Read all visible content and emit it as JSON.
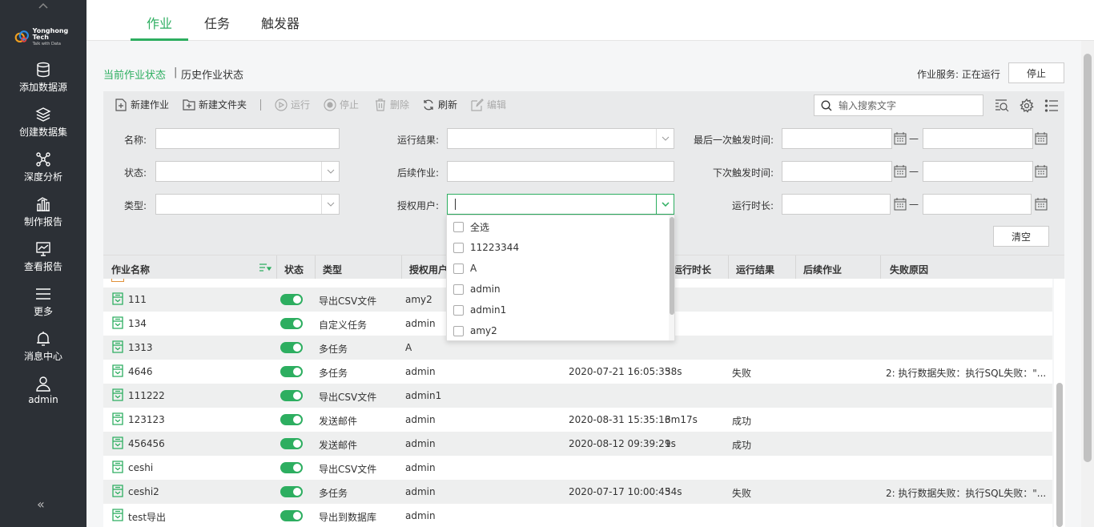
{
  "sidebar": {
    "logo_line1": "Yonghong Tech",
    "logo_line2": "Talk with Data",
    "items": [
      {
        "label": "添加数据源",
        "icon": "database-icon"
      },
      {
        "label": "创建数据集",
        "icon": "layers-icon"
      },
      {
        "label": "深度分析",
        "icon": "network-icon"
      },
      {
        "label": "制作报告",
        "icon": "bar-chart-icon"
      },
      {
        "label": "查看报告",
        "icon": "monitor-chart-icon"
      },
      {
        "label": "更多",
        "icon": "menu-icon"
      },
      {
        "label": "消息中心",
        "icon": "bell-icon"
      },
      {
        "label": "admin",
        "icon": "user-icon"
      }
    ],
    "collapse": "«"
  },
  "tabs": [
    {
      "label": "作业",
      "active": true
    },
    {
      "label": "任务",
      "active": false
    },
    {
      "label": "触发器",
      "active": false
    }
  ],
  "status": {
    "current": "当前作业状态",
    "separator": "|",
    "history": "历史作业状态",
    "service_text": "作业服务: 正在运行",
    "stop_label": "停止"
  },
  "toolbar": {
    "new_job": "新建作业",
    "new_folder": "新建文件夹",
    "run": "运行",
    "stop": "停止",
    "delete": "删除",
    "refresh": "刷新",
    "edit": "编辑",
    "search_placeholder": "输入搜索文字"
  },
  "filters": {
    "name": "名称:",
    "status": "状态:",
    "type": "类型:",
    "run_result": "运行结果:",
    "next_job": "后续作业:",
    "auth_user": "授权用户:",
    "last_trigger": "最后一次触发时间:",
    "next_trigger": "下次触发时间:",
    "run_duration": "运行时长:",
    "dash": "—",
    "clear": "清空"
  },
  "dropdown_options": [
    "全选",
    "11223344",
    "A",
    "admin",
    "admin1",
    "amy2"
  ],
  "table": {
    "headers": [
      "作业名称",
      "状态",
      "类型",
      "授权用户",
      "运行时长",
      "运行结果",
      "后续作业",
      "失败原因"
    ],
    "rows": [
      {
        "name": "111",
        "type": "导出CSV文件",
        "user": "amy2",
        "time": "",
        "duration": "",
        "result": "",
        "reason": ""
      },
      {
        "name": "134",
        "type": "自定义任务",
        "user": "admin",
        "time": "",
        "duration": "",
        "result": "",
        "reason": ""
      },
      {
        "name": "1313",
        "type": "多任务",
        "user": "A",
        "time": "",
        "duration": "",
        "result": "",
        "reason": ""
      },
      {
        "name": "4646",
        "type": "多任务",
        "user": "admin",
        "time": "2020-07-21 16:05:35",
        "duration": "38s",
        "result": "失败",
        "reason": "2: 执行数据失败：执行SQL失败：\"..."
      },
      {
        "name": "111222",
        "type": "导出CSV文件",
        "user": "admin1",
        "time": "",
        "duration": "",
        "result": "",
        "reason": ""
      },
      {
        "name": "123123",
        "type": "发送邮件",
        "user": "admin",
        "time": "2020-08-31 15:35:16",
        "duration": "3m17s",
        "result": "成功",
        "reason": ""
      },
      {
        "name": "456456",
        "type": "发送邮件",
        "user": "admin",
        "time": "2020-08-12 09:39:21",
        "duration": "9s",
        "result": "成功",
        "reason": ""
      },
      {
        "name": "ceshi",
        "type": "导出CSV文件",
        "user": "admin",
        "time": "",
        "duration": "",
        "result": "",
        "reason": ""
      },
      {
        "name": "ceshi2",
        "type": "多任务",
        "user": "admin",
        "time": "2020-07-17 10:00:43",
        "duration": "54s",
        "result": "失败",
        "reason": "2: 执行数据失败：执行SQL失败：\"..."
      },
      {
        "name": "test导出",
        "type": "导出到数据库",
        "user": "admin",
        "time": "",
        "duration": "",
        "result": "",
        "reason": ""
      }
    ]
  },
  "colors": {
    "accent": "#2dae60",
    "sidebar": "#2c3036"
  }
}
